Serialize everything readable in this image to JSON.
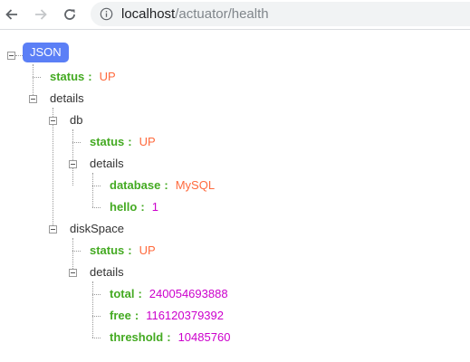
{
  "browser": {
    "url_host": "localhost",
    "url_path": "/actuator/health"
  },
  "tree": {
    "root_label": "JSON",
    "status_key": "status",
    "status_value": "UP",
    "details_label": "details",
    "db": {
      "label": "db",
      "status_key": "status",
      "status_value": "UP",
      "details_label": "details",
      "database_key": "database",
      "database_value": "MySQL",
      "hello_key": "hello",
      "hello_value": "1"
    },
    "diskSpace": {
      "label": "diskSpace",
      "status_key": "status",
      "status_value": "UP",
      "details_label": "details",
      "total_key": "total",
      "total_value": "240054693888",
      "free_key": "free",
      "free_value": "116120379392",
      "threshold_key": "threshold",
      "threshold_value": "10485760"
    },
    "separator": ":"
  }
}
